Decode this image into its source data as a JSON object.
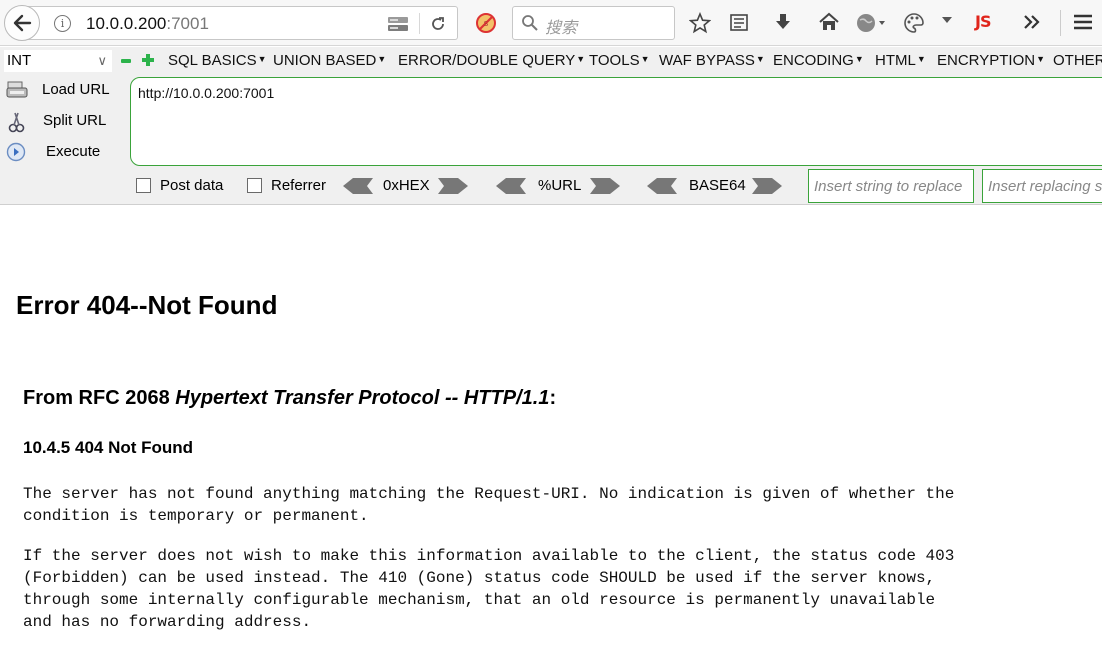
{
  "browser": {
    "url_host": "10.0.0.200",
    "url_port": ":7001",
    "search_placeholder": "搜索",
    "js_badge": "JS"
  },
  "hackbar": {
    "int_select": "INT",
    "menus": [
      {
        "label": "SQL BASICS"
      },
      {
        "label": "UNION BASED"
      },
      {
        "label": "ERROR/DOUBLE QUERY"
      },
      {
        "label": "TOOLS"
      },
      {
        "label": "WAF BYPASS"
      },
      {
        "label": "ENCODING"
      },
      {
        "label": "HTML"
      },
      {
        "label": "ENCRYPTION"
      },
      {
        "label": "OTHER"
      }
    ],
    "load_url": "Load URL",
    "split_url": "Split URL",
    "execute": "Execute",
    "url_value": "http://10.0.0.200:7001",
    "post_data": "Post data",
    "referrer": "Referrer",
    "hex": "0xHEX",
    "url_enc": "%URL",
    "base64": "BASE64",
    "replace_placeholder": "Insert string to replace",
    "replacing_placeholder": "Insert replacing string"
  },
  "page": {
    "title": "Error 404--Not Found",
    "rfc_prefix": "From RFC 2068 ",
    "rfc_title": "Hypertext Transfer Protocol -- HTTP/1.1",
    "rfc_suffix": ":",
    "section": "10.4.5 404 Not Found",
    "para1": "The server has not found anything matching the Request-URI. No indication is given of whether the\ncondition is temporary or permanent.",
    "para2": "If the server does not wish to make this information available to the client, the status code 403\n(Forbidden) can be used instead. The 410 (Gone) status code SHOULD be used if the server knows,\nthrough some internally configurable mechanism, that an old resource is permanently unavailable\nand has no forwarding address."
  }
}
